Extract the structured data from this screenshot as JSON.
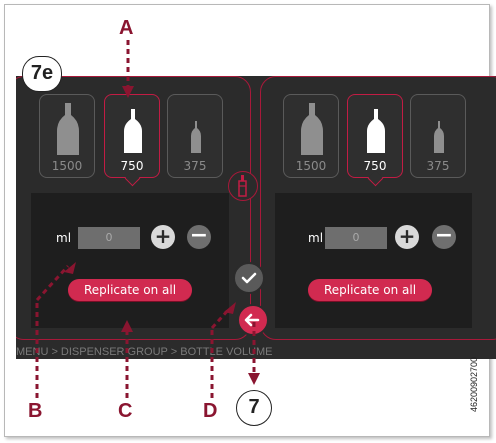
{
  "step_badge": "7e",
  "callouts": {
    "a": "A",
    "b": "B",
    "c": "C",
    "d": "D",
    "step": "7"
  },
  "left_panel": {
    "bottles": [
      {
        "size": "1500",
        "selected": false
      },
      {
        "size": "750",
        "selected": true
      },
      {
        "size": "375",
        "selected": false
      }
    ],
    "unit_label": "ml",
    "volume_value": "0",
    "replicate_label": "Replicate on all"
  },
  "right_panel": {
    "bottles": [
      {
        "size": "1500",
        "selected": false
      },
      {
        "size": "750",
        "selected": true
      },
      {
        "size": "375",
        "selected": false
      }
    ],
    "unit_label": "ml",
    "volume_value": "0",
    "replicate_label": "Replicate on all"
  },
  "breadcrumb": "MENU > DISPENSER GROUP > BOTTLE VOLUME",
  "doc_number": "46200902700",
  "icons": {
    "center": "wine-bottle-icon",
    "confirm": "check-icon",
    "back": "arrow-left-icon",
    "plus": "plus-icon",
    "minus": "minus-icon"
  },
  "colors": {
    "accent": "#d12a50",
    "panel_border": "#a8193a",
    "screen_bg": "#2b2b2b",
    "callout": "#8a1530"
  }
}
